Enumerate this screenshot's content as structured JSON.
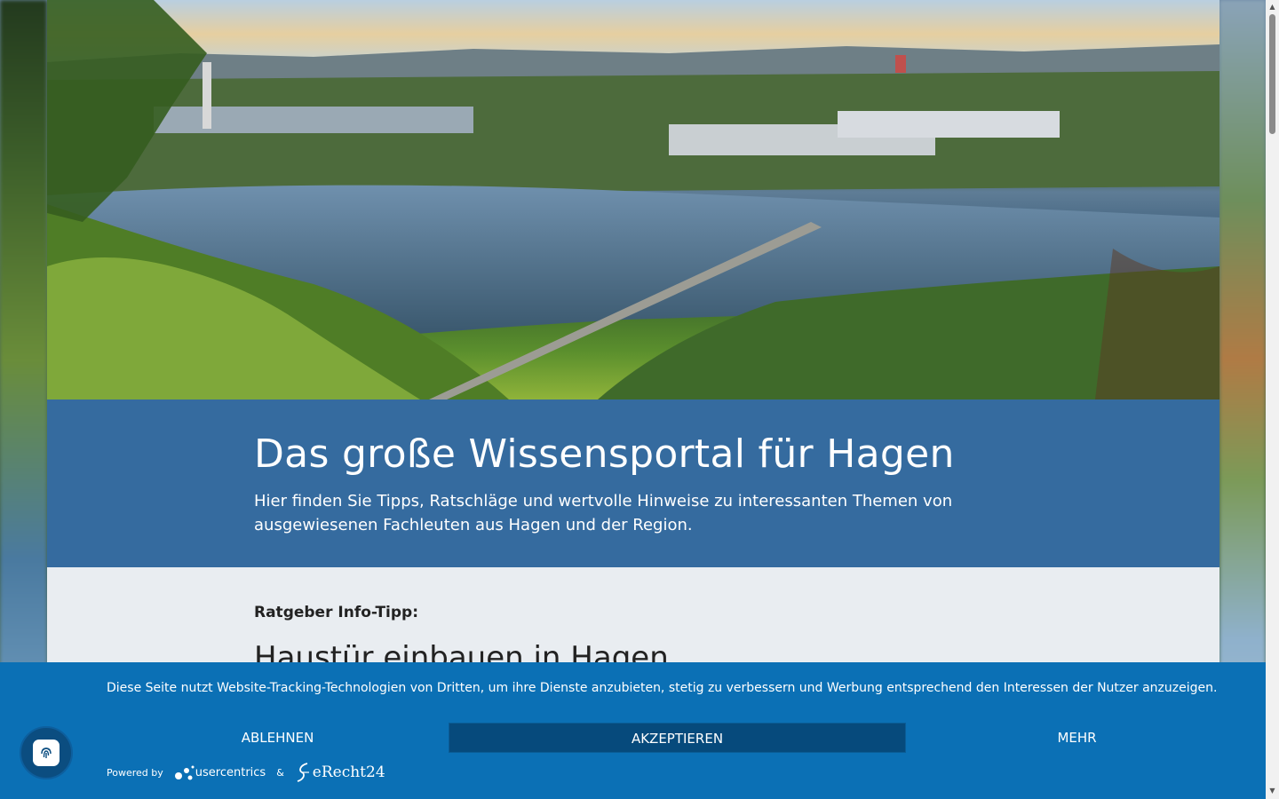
{
  "banner": {
    "title": "Das große Wissensportal für Hagen",
    "subtitle": "Hier finden Sie Tipps, Ratschläge und wertvolle Hinweise zu interessanten Themen von ausgewiesenen Fachleuten aus Hagen und der Region."
  },
  "content": {
    "tip_label": "Ratgeber Info-Tipp:",
    "article_title": "Haustür einbauen in Hagen"
  },
  "cookie": {
    "message": "Diese Seite nutzt Website-Tracking-Technologien von Dritten, um ihre Dienste anzubieten, stetig zu verbessern und Werbung entsprechend den Interessen der Nutzer anzuzeigen.",
    "deny_label": "ABLEHNEN",
    "accept_label": "AKZEPTIEREN",
    "more_label": "MEHR",
    "powered_by": "Powered by",
    "usercentrics": "usercentrics",
    "ampersand": "&",
    "erecht": "eRecht24"
  },
  "colors": {
    "banner_blue": "#356b9f",
    "cookie_blue": "#0b70b5",
    "accept_dark": "#064a7c"
  },
  "icons": {
    "fab": "fingerprint-icon"
  }
}
